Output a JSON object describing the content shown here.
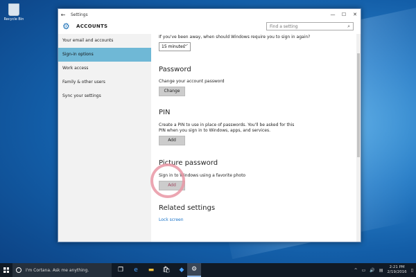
{
  "desktop": {
    "recycle_bin_label": "Recycle Bin"
  },
  "window": {
    "title": "Settings",
    "section": "ACCOUNTS",
    "search_placeholder": "Find a setting"
  },
  "sidebar": {
    "items": [
      {
        "label": "Your email and accounts"
      },
      {
        "label": "Sign-in options"
      },
      {
        "label": "Work access"
      },
      {
        "label": "Family & other users"
      },
      {
        "label": "Sync your settings"
      }
    ]
  },
  "content": {
    "require_signin_question": "If you've been away, when should Windows require you to sign in again?",
    "require_signin_value": "15 minutes",
    "password": {
      "heading": "Password",
      "description": "Change your account password",
      "button": "Change"
    },
    "pin": {
      "heading": "PIN",
      "description_line1": "Create a PIN to use in place of passwords. You'll be asked for this",
      "description_line2": "PIN when you sign in to Windows, apps, and services.",
      "button": "Add"
    },
    "picture_password": {
      "heading": "Picture password",
      "description": "Sign in to Windows using a favorite photo",
      "button": "Add"
    },
    "related": {
      "heading": "Related settings",
      "link": "Lock screen"
    }
  },
  "taskbar": {
    "search_placeholder": "I'm Cortana. Ask me anything.",
    "time": "2:21 PM",
    "date": "2/19/2016",
    "icons": [
      "task-view-icon",
      "edge-icon",
      "file-explorer-icon",
      "store-icon",
      "dropbox-icon",
      "settings-icon"
    ]
  }
}
